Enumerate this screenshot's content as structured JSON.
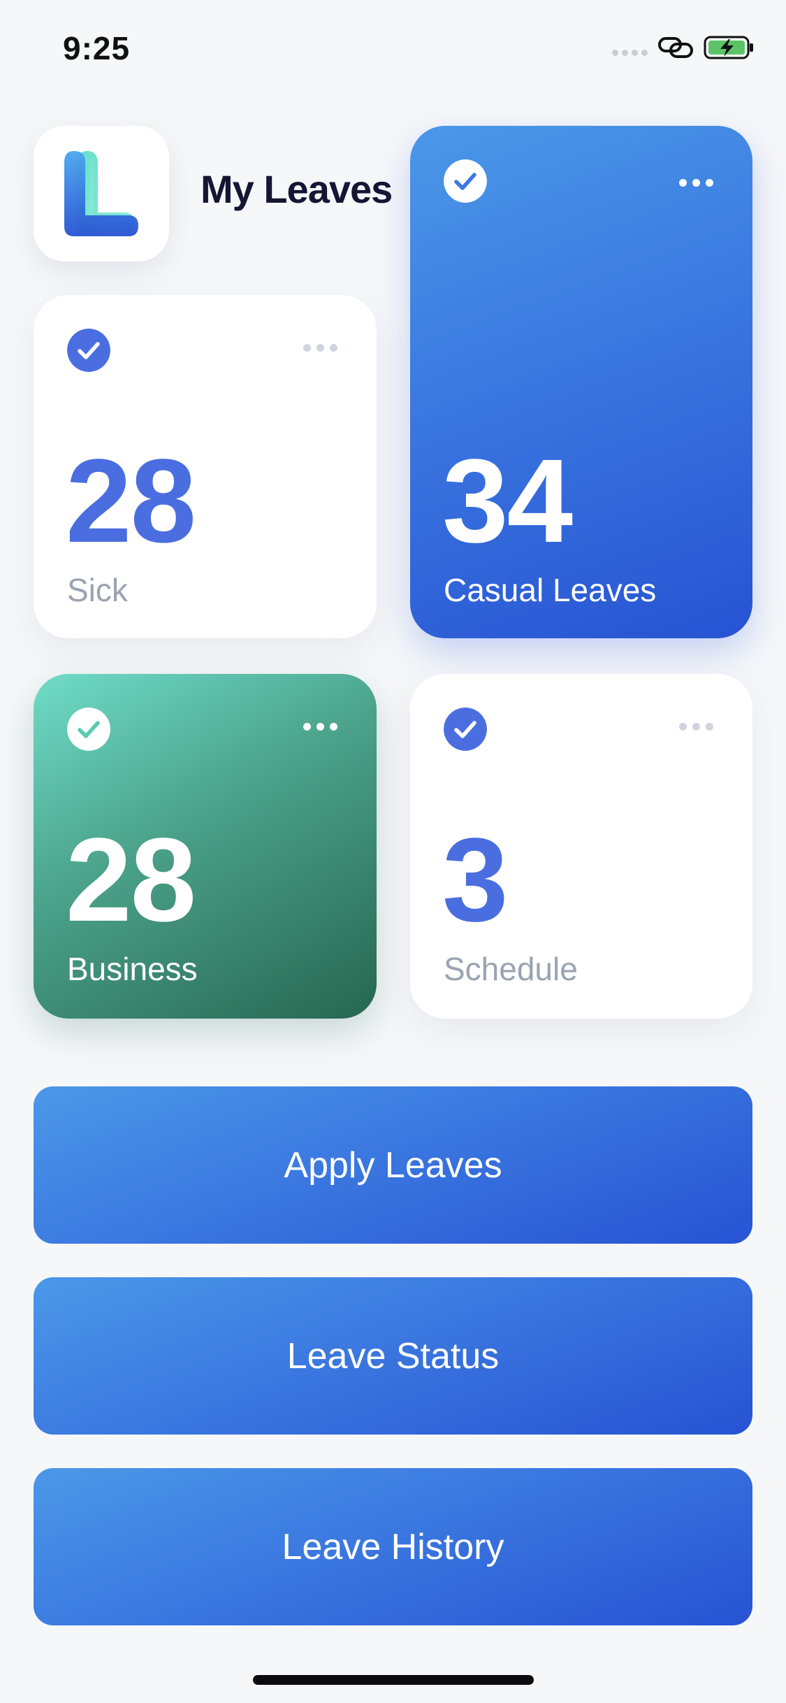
{
  "status_bar": {
    "time": "9:25"
  },
  "header": {
    "title": "My Leaves",
    "logo_icon": "leaves-app-logo-icon"
  },
  "cards": {
    "sick": {
      "value": "28",
      "label": "Sick"
    },
    "casual": {
      "value": "34",
      "label": "Casual Leaves"
    },
    "business": {
      "value": "28",
      "label": "Business"
    },
    "schedule": {
      "value": "3",
      "label": "Schedule"
    }
  },
  "actions": {
    "apply": "Apply Leaves",
    "status": "Leave Status",
    "history": "Leave History"
  },
  "colors": {
    "accent_blue": "#3b78e0",
    "accent_green": "#4aa088",
    "label_gray": "#9aa3b2",
    "title": "#141633"
  }
}
